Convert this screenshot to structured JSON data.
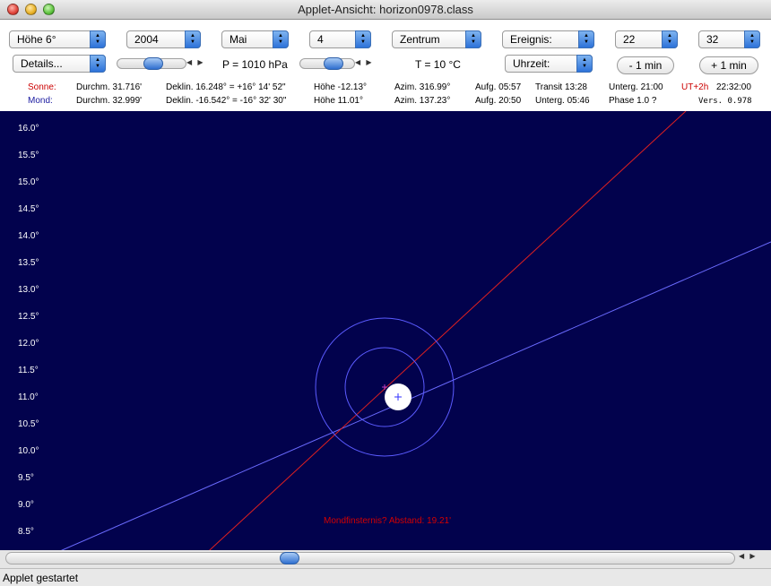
{
  "window": {
    "title": "Applet-Ansicht: horizon0978.class"
  },
  "controls": {
    "hoehe": "Höhe 6°",
    "year": "2004",
    "month": "Mai",
    "day": "4",
    "view": "Zentrum",
    "event": "Ereignis:",
    "hour": "22",
    "minute": "32",
    "details": "Details...",
    "pressure": "P = 1010 hPa",
    "temperature": "T = 10 °C",
    "clock": "Uhrzeit:",
    "minus_min": "- 1 min",
    "plus_min": "+ 1 min"
  },
  "sun": {
    "label": "Sonne:",
    "diameter": "Durchm. 31.716'",
    "declination": "Deklin. 16.248° = +16° 14' 52\"",
    "altitude": "Höhe -12.13°",
    "azimuth": "Azim. 316.99°",
    "rise": "Aufg. 05:57",
    "transit": "Transit 13:28",
    "set": "Unterg. 21:00",
    "tz": "UT+2h",
    "time": "22:32:00"
  },
  "moon": {
    "label": "Mond:",
    "diameter": "Durchm. 32.999'",
    "declination": "Deklin. -16.542° = -16° 32' 30\"",
    "altitude": "Höhe 11.01°",
    "azimuth": "Azim. 137.23°",
    "rise": "Aufg. 20:50",
    "set": "Unterg. 05:46",
    "phase": "Phase 1.0 ?",
    "version": "Vers. 0.978"
  },
  "sky": {
    "y_labels": [
      "16.0°",
      "15.5°",
      "15.0°",
      "14.5°",
      "14.0°",
      "13.5°",
      "13.0°",
      "12.5°",
      "12.0°",
      "11.5°",
      "11.0°",
      "10.5°",
      "10.0°",
      "9.5°",
      "9.0°",
      "8.5°"
    ],
    "eclipse_text": "Mondfinsternis? Abstand: 19.21'",
    "colors": {
      "background": "#02024d",
      "ecliptic": "#6b6bff",
      "equator": "#e02020",
      "moon": "#ffffff",
      "circles": "#5b5bff",
      "eclipse_text": "#d40000"
    }
  },
  "status": {
    "text": "Applet gestartet"
  }
}
